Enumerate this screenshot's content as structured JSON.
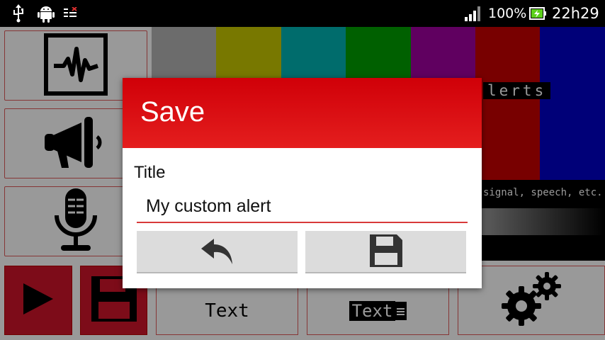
{
  "status_bar": {
    "battery_percent": "100%",
    "time": "22h29"
  },
  "sidebar": {
    "items": [
      {
        "icon": "waveform-icon"
      },
      {
        "icon": "megaphone-icon"
      },
      {
        "icon": "microphone-icon"
      }
    ]
  },
  "controls": {
    "play_icon": "play-icon",
    "save_icon": "floppy-disk-icon",
    "settings_icon": "gears-icon"
  },
  "bottom_bar": {
    "text_button_label": "Text",
    "text_inverted_button_label": "Text"
  },
  "preview": {
    "label_fragment": "lerts",
    "caption_fragment": "signal, speech, etc."
  },
  "colors": {
    "accent_red": "#d0142a",
    "dialog_header": "#e01818",
    "colorbars": [
      "#b4b4b4",
      "#c8c800",
      "#00b4b4",
      "#00a000",
      "#a000a0",
      "#c80000",
      "#0000c8"
    ]
  },
  "dialog": {
    "title": "Save",
    "field_label": "Title",
    "input_value": "My custom alert",
    "back_icon": "undo-arrow-icon",
    "save_icon": "floppy-disk-icon"
  }
}
